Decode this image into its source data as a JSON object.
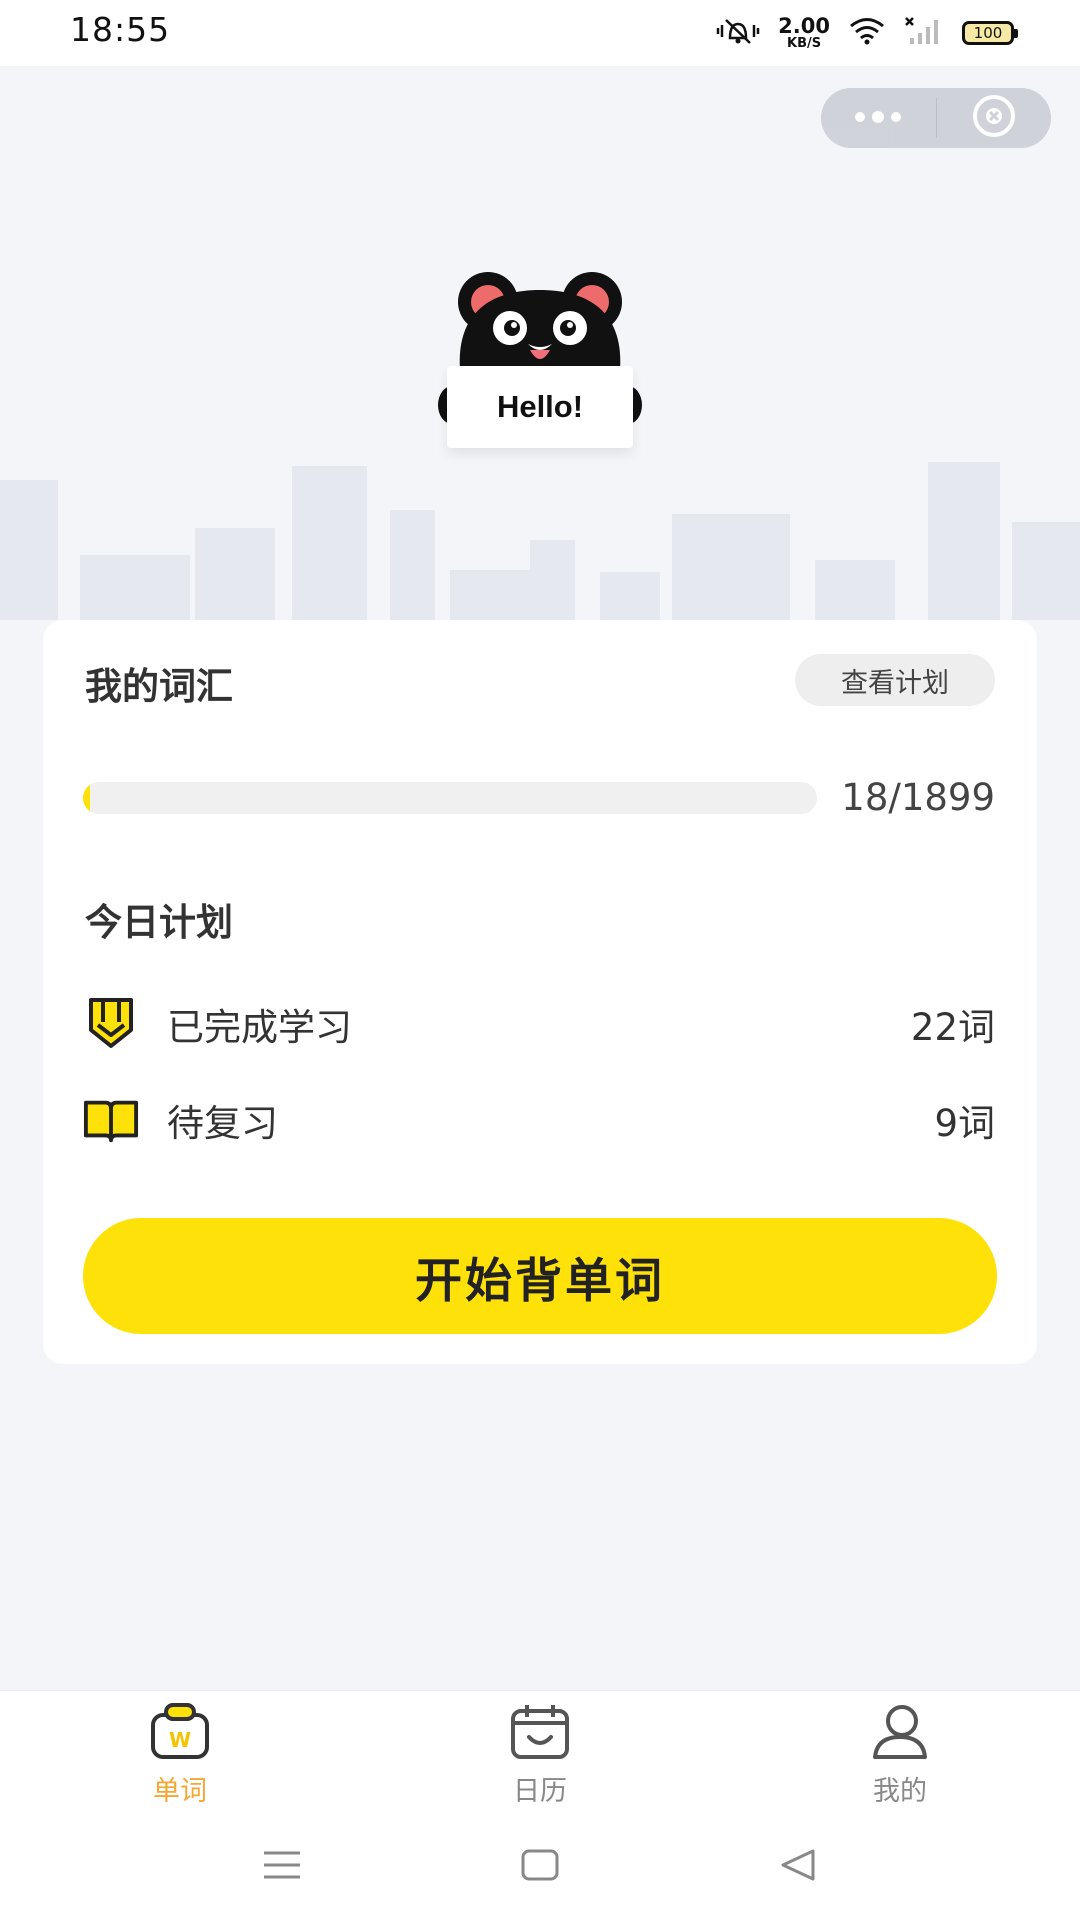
{
  "status_bar": {
    "time": "18:55",
    "net_speed_value": "2.00",
    "net_speed_unit": "KB/S",
    "battery": "100",
    "icons": [
      "vibrate-mute-icon",
      "wifi-icon",
      "signal-icon",
      "battery-icon"
    ]
  },
  "capsule": {
    "icons": [
      "more-dots-icon",
      "close-circle-icon"
    ]
  },
  "hero": {
    "mascot": "bear-mascot",
    "hello": "Hello!"
  },
  "vocab": {
    "title": "我的词汇",
    "plan_button": "查看计划",
    "progress_text": "18/1899",
    "progress_fraction": 0.0095
  },
  "today": {
    "title": "今日计划",
    "items": [
      {
        "label": "已完成学习",
        "value": "22词",
        "icon": "pencil-badge-icon"
      },
      {
        "label": "待复习",
        "value": "9词",
        "icon": "open-book-icon"
      }
    ]
  },
  "start_button": "开始背单词",
  "tabs": [
    {
      "label": "单词",
      "icon": "word-bag-icon",
      "active": true
    },
    {
      "label": "日历",
      "icon": "calendar-face-icon",
      "active": false
    },
    {
      "label": "我的",
      "icon": "user-profile-icon",
      "active": false
    }
  ],
  "colors": {
    "accent_yellow": "#ffe10a",
    "active_tab": "#f5a733",
    "background": "#f4f5f9"
  }
}
